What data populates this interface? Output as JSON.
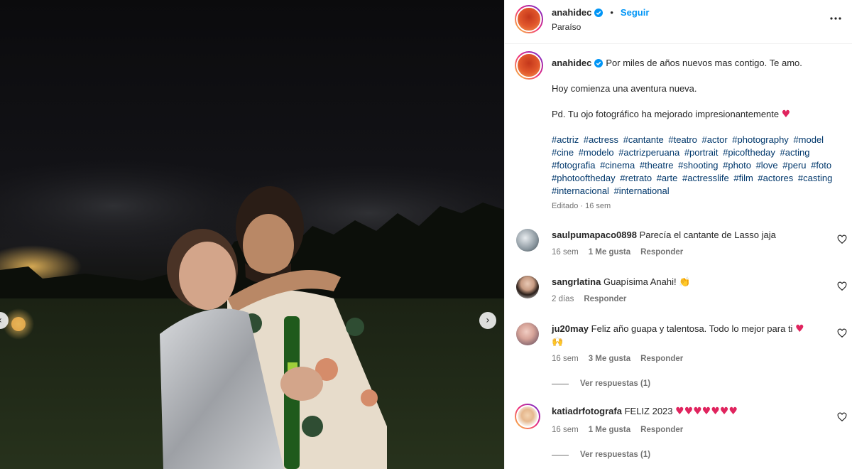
{
  "post": {
    "username": "anahidec",
    "follow_label": "Seguir",
    "location": "Paraíso",
    "separator": "•"
  },
  "caption": {
    "username": "anahidec",
    "line1": "Por miles de años nuevos mas contigo. Te amo.",
    "line2": "Hoy comienza una aventura nueva.",
    "line3": "Pd. Tu ojo fotográfico ha mejorado impresionantemente",
    "hashtags": [
      "#actriz",
      "#actress",
      "#cantante",
      "#teatro",
      "#actor",
      "#photography",
      "#model",
      "#cine",
      "#modelo",
      "#actrizperuana",
      "#portrait",
      "#picoftheday",
      "#acting",
      "#fotografia",
      "#cinema",
      "#theatre",
      "#shooting",
      "#photo",
      "#love",
      "#peru",
      "#foto",
      "#photooftheday",
      "#retrato",
      "#arte",
      "#actresslife",
      "#film",
      "#actores",
      "#casting",
      "#internacional",
      "#international"
    ],
    "edited": "Editado",
    "time": "16 sem"
  },
  "comments": [
    {
      "user": "saulpumapaco0898",
      "text": "Parecía el cantante de Lasso jaja",
      "time": "16 sem",
      "likes": "1 Me gusta",
      "reply": "Responder"
    },
    {
      "user": "sangrlatina",
      "text": "Guapísima Anahi!",
      "time": "2 días",
      "reply": "Responder"
    },
    {
      "user": "ju20may",
      "text": "Feliz año guapa y talentosa. Todo lo mejor para ti",
      "time": "16 sem",
      "likes": "3 Me gusta",
      "reply": "Responder",
      "replies": "Ver respuestas (1)"
    },
    {
      "user": "katiadrfotografa",
      "text": "FELIZ 2023",
      "time": "16 sem",
      "likes": "1 Me gusta",
      "reply": "Responder",
      "replies": "Ver respuestas (1)"
    }
  ],
  "icons": {
    "verified": "verified-badge-icon",
    "more": "more-options-icon",
    "next": "chevron-right-icon",
    "heart": "heart-outline-icon"
  },
  "colors": {
    "accent": "#0095f6",
    "hashtag": "#00376b",
    "muted": "#737373",
    "heart": "#e0245e"
  }
}
